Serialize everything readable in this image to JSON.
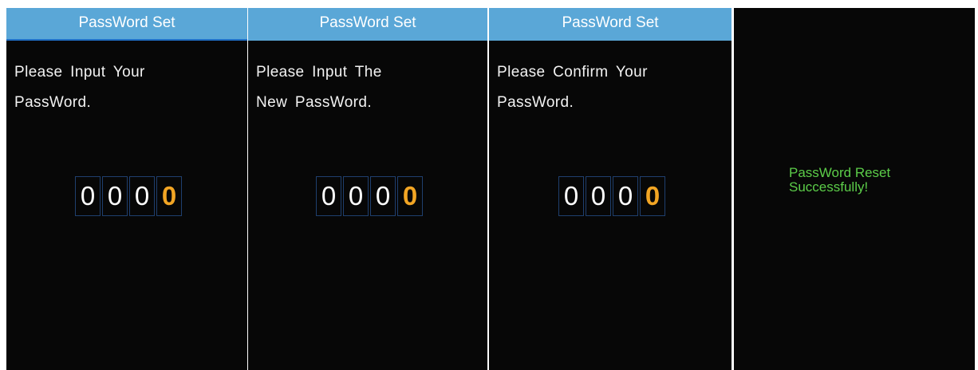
{
  "screens": [
    {
      "title": "PassWord Set",
      "prompt_line1": "Please Input Your",
      "prompt_line2": "PassWord.",
      "digits": [
        "0",
        "0",
        "0",
        "0"
      ]
    },
    {
      "title": "PassWord Set",
      "prompt_line1": "Please Input The",
      "prompt_line2": "New PassWord.",
      "digits": [
        "0",
        "0",
        "0",
        "0"
      ]
    },
    {
      "title": "PassWord Set",
      "prompt_line1": "Please Confirm Your",
      "prompt_line2": "PassWord.",
      "digits": [
        "0",
        "0",
        "0",
        "0"
      ]
    }
  ],
  "result": {
    "line1": "PassWord Reset",
    "line2": "Successfully!"
  },
  "colors": {
    "title_bar": "#5aa7d7",
    "screen_background": "#070707",
    "active_digit": "#f2a524",
    "success_text": "#5ccd49"
  }
}
